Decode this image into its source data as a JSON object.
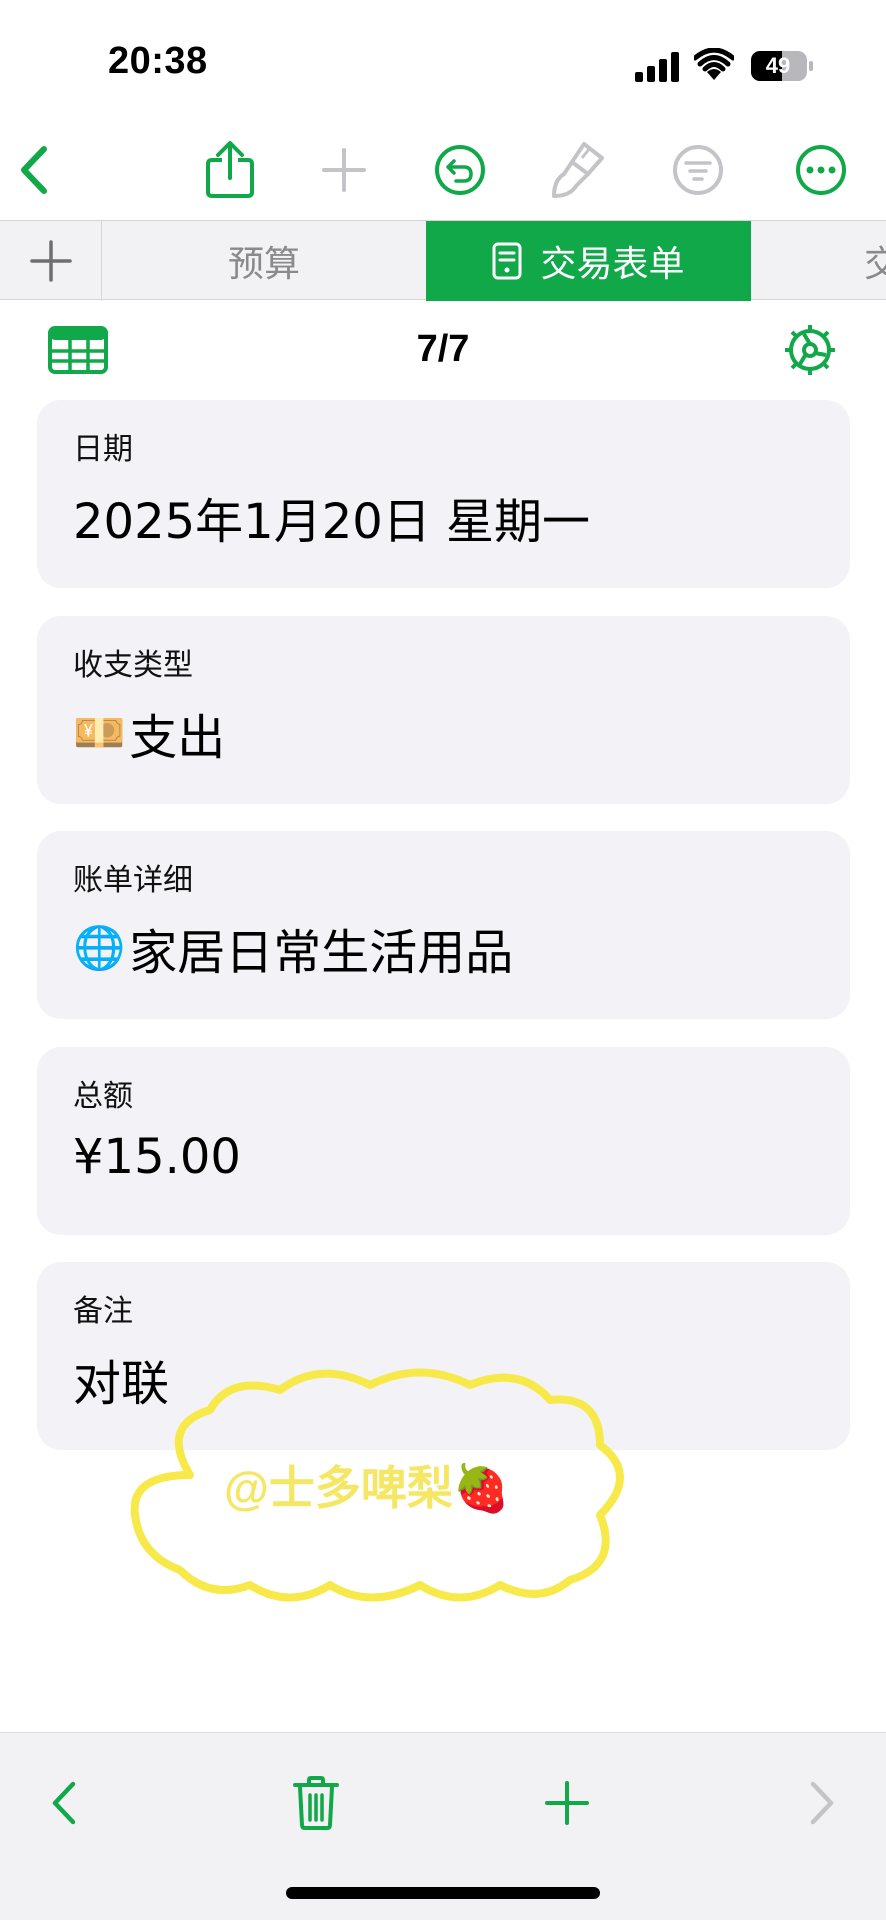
{
  "status_bar": {
    "time": "20:38",
    "battery": "49"
  },
  "toolbar": {
    "icons": [
      "back-chevron-icon",
      "share-icon",
      "add-icon",
      "undo-icon",
      "brush-icon",
      "filter-icon",
      "more-icon"
    ],
    "accent": "#11a84a",
    "disabled": "#c4c4c8"
  },
  "tabs": {
    "add": "+",
    "items": [
      {
        "label": "预算",
        "active": false
      },
      {
        "label": "交易表单",
        "active": true
      },
      {
        "label": "交",
        "active": false
      }
    ]
  },
  "form": {
    "page_counter": "7/7",
    "fields": [
      {
        "label": "日期",
        "value": "2025年1月20日 星期一",
        "emoji": ""
      },
      {
        "label": "收支类型",
        "value": "支出",
        "emoji": "💴"
      },
      {
        "label": "账单详细",
        "value": "家居日常生活用品",
        "emoji": "🌐"
      },
      {
        "label": "总额",
        "value": "¥15.00",
        "emoji": ""
      },
      {
        "label": "备注",
        "value": "对联",
        "emoji": ""
      }
    ]
  },
  "watermark": {
    "text": "@士多啤梨🍓",
    "color": "#f5e663"
  },
  "bottom_bar": {
    "icons": [
      "previous-icon",
      "trash-icon",
      "add-record-icon",
      "next-icon"
    ]
  }
}
